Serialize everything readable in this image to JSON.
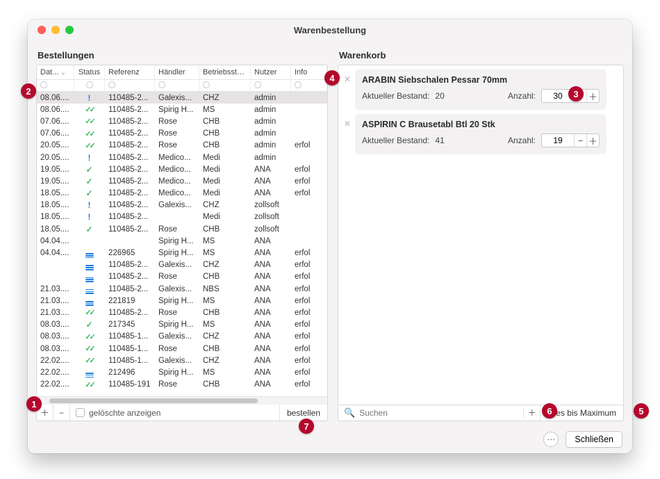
{
  "window": {
    "title": "Warenbestellung"
  },
  "left": {
    "title": "Bestellungen",
    "columns": {
      "date": "Dat...",
      "status": "Status",
      "ref": "Referenz",
      "vendor": "Händler",
      "site": "Betriebsstät...",
      "user": "Nutzer",
      "info": "Info"
    },
    "footer": {
      "show_deleted": "gelöschte anzeigen",
      "order": "bestellen"
    }
  },
  "orders": [
    {
      "date": "08.06....",
      "status": "excl",
      "ref": "110485-2...",
      "vendor": "Galexis...",
      "site": "CHZ",
      "user": "admin",
      "info": "",
      "selected": true
    },
    {
      "date": "08.06....",
      "status": "double",
      "ref": "110485-2...",
      "vendor": "Spirig H...",
      "site": "MS",
      "user": "admin",
      "info": ""
    },
    {
      "date": "07.06....",
      "status": "double",
      "ref": "110485-2...",
      "vendor": "Rose",
      "site": "CHB",
      "user": "admin",
      "info": ""
    },
    {
      "date": "07.06....",
      "status": "double",
      "ref": "110485-2...",
      "vendor": "Rose",
      "site": "CHB",
      "user": "admin",
      "info": ""
    },
    {
      "date": "20.05....",
      "status": "double",
      "ref": "110485-2...",
      "vendor": "Rose",
      "site": "CHB",
      "user": "admin",
      "info": "erfol"
    },
    {
      "date": "20.05....",
      "status": "excl",
      "ref": "110485-2...",
      "vendor": "Medico...",
      "site": "Medi",
      "user": "admin",
      "info": ""
    },
    {
      "date": "19.05....",
      "status": "single",
      "ref": "110485-2...",
      "vendor": "Medico...",
      "site": "Medi",
      "user": "ANA",
      "info": "erfol"
    },
    {
      "date": "19.05....",
      "status": "single",
      "ref": "110485-2...",
      "vendor": "Medico...",
      "site": "Medi",
      "user": "ANA",
      "info": "erfol"
    },
    {
      "date": "18.05....",
      "status": "single",
      "ref": "110485-2...",
      "vendor": "Medico...",
      "site": "Medi",
      "user": "ANA",
      "info": "erfol"
    },
    {
      "date": "18.05....",
      "status": "excl",
      "ref": "110485-2...",
      "vendor": "Galexis...",
      "site": "CHZ",
      "user": "zollsoft",
      "info": ""
    },
    {
      "date": "18.05....",
      "status": "excl",
      "ref": "110485-2...",
      "vendor": "",
      "site": "Medi",
      "user": "zollsoft",
      "info": ""
    },
    {
      "date": "18.05....",
      "status": "single",
      "ref": "110485-2...",
      "vendor": "Rose",
      "site": "CHB",
      "user": "zollsoft",
      "info": ""
    },
    {
      "date": "04.04....",
      "status": "",
      "ref": "",
      "vendor": "Spirig H...",
      "site": "MS",
      "user": "ANA",
      "info": ""
    },
    {
      "date": "04.04....",
      "status": "lines",
      "ref": "226965",
      "vendor": "Spirig H...",
      "site": "MS",
      "user": "ANA",
      "info": "erfol"
    },
    {
      "date": "",
      "status": "lines",
      "ref": "110485-2...",
      "vendor": "Galexis...",
      "site": "CHZ",
      "user": "ANA",
      "info": "erfol"
    },
    {
      "date": "",
      "status": "lines",
      "ref": "110485-2...",
      "vendor": "Rose",
      "site": "CHB",
      "user": "ANA",
      "info": "erfol"
    },
    {
      "date": "21.03....",
      "status": "lines",
      "ref": "110485-2...",
      "vendor": "Galexis...",
      "site": "NBS",
      "user": "ANA",
      "info": "erfol"
    },
    {
      "date": "21.03....",
      "status": "lines",
      "ref": "221819",
      "vendor": "Spirig H...",
      "site": "MS",
      "user": "ANA",
      "info": "erfol"
    },
    {
      "date": "21.03....",
      "status": "double",
      "ref": "110485-2...",
      "vendor": "Rose",
      "site": "CHB",
      "user": "ANA",
      "info": "erfol"
    },
    {
      "date": "08.03....",
      "status": "single",
      "ref": "217345",
      "vendor": "Spirig H...",
      "site": "MS",
      "user": "ANA",
      "info": "erfol"
    },
    {
      "date": "08.03....",
      "status": "double",
      "ref": "110485-1...",
      "vendor": "Galexis...",
      "site": "CHZ",
      "user": "ANA",
      "info": "erfol"
    },
    {
      "date": "08.03....",
      "status": "double",
      "ref": "110485-1...",
      "vendor": "Rose",
      "site": "CHB",
      "user": "ANA",
      "info": "erfol"
    },
    {
      "date": "22.02....",
      "status": "double",
      "ref": "110485-1...",
      "vendor": "Galexis...",
      "site": "CHZ",
      "user": "ANA",
      "info": "erfol"
    },
    {
      "date": "22.02....",
      "status": "lines",
      "ref": "212496",
      "vendor": "Spirig H...",
      "site": "MS",
      "user": "ANA",
      "info": "erfol"
    },
    {
      "date": "22.02....",
      "status": "double",
      "ref": "110485-191",
      "vendor": "Rose",
      "site": "CHB",
      "user": "ANA",
      "info": "erfol"
    }
  ],
  "right": {
    "title": "Warenkorb",
    "stock_label": "Aktueller Bestand:",
    "qty_label": "Anzahl:",
    "footer": {
      "search_placeholder": "Suchen",
      "max": "alles bis Maximum"
    }
  },
  "cart": [
    {
      "name": "ARABIN Siebschalen Pessar 70mm",
      "stock": "20",
      "qty": "30"
    },
    {
      "name": "ASPIRIN C Brausetabl Btl 20 Stk",
      "stock": "41",
      "qty": "19"
    }
  ],
  "bottom": {
    "close": "Schließen"
  },
  "annotations": {
    "b1": "1",
    "b2": "2",
    "b3": "3",
    "b4": "4",
    "b5": "5",
    "b6": "6",
    "b7": "7"
  }
}
